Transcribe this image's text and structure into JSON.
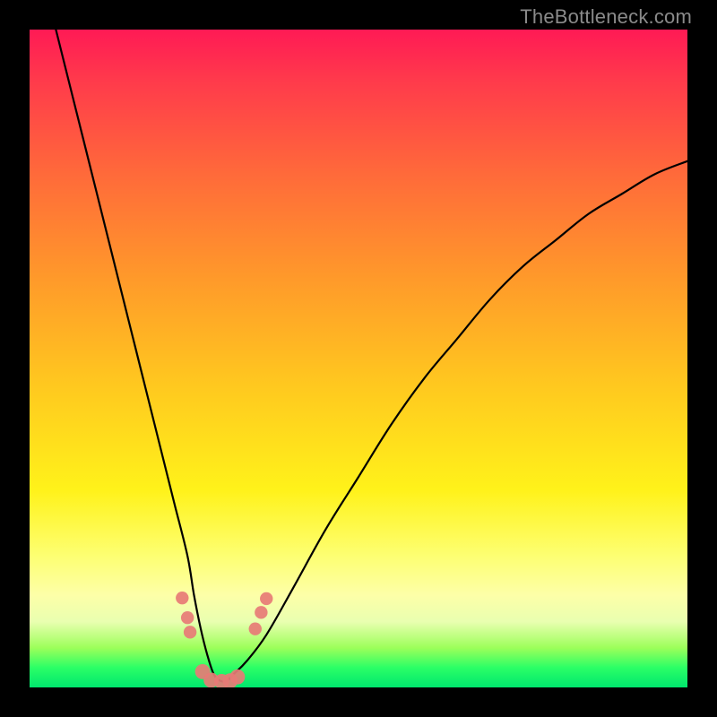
{
  "watermark": {
    "text": "TheBottleneck.com"
  },
  "chart_data": {
    "type": "line",
    "title": "",
    "xlabel": "",
    "ylabel": "",
    "xlim": [
      0,
      100
    ],
    "ylim": [
      0,
      100
    ],
    "grid": false,
    "legend": false,
    "series": [
      {
        "name": "curve",
        "color": "#000000",
        "x": [
          4,
          6,
          8,
          10,
          12,
          14,
          16,
          18,
          20,
          22,
          24,
          25,
          26,
          27,
          28,
          29,
          30,
          31,
          33,
          36,
          40,
          45,
          50,
          55,
          60,
          65,
          70,
          75,
          80,
          85,
          90,
          95,
          100
        ],
        "y": [
          100,
          92,
          84,
          76,
          68,
          60,
          52,
          44,
          36,
          28,
          20,
          14,
          9,
          5,
          2,
          1,
          1,
          2,
          4,
          8,
          15,
          24,
          32,
          40,
          47,
          53,
          59,
          64,
          68,
          72,
          75,
          78,
          80
        ]
      }
    ],
    "markers": [
      {
        "x": 23.2,
        "y": 13.6,
        "r": 1.2,
        "color": "#e77b76"
      },
      {
        "x": 24.0,
        "y": 10.6,
        "r": 1.2,
        "color": "#e77b76"
      },
      {
        "x": 24.4,
        "y": 8.4,
        "r": 1.2,
        "color": "#e77b76"
      },
      {
        "x": 26.3,
        "y": 2.4,
        "r": 1.4,
        "color": "#e77b76"
      },
      {
        "x": 27.6,
        "y": 1.1,
        "r": 1.4,
        "color": "#e77b76"
      },
      {
        "x": 29.2,
        "y": 0.9,
        "r": 1.4,
        "color": "#e77b76"
      },
      {
        "x": 30.5,
        "y": 1.0,
        "r": 1.4,
        "color": "#e77b76"
      },
      {
        "x": 31.6,
        "y": 1.6,
        "r": 1.4,
        "color": "#e77b76"
      },
      {
        "x": 34.3,
        "y": 8.9,
        "r": 1.2,
        "color": "#e77b76"
      },
      {
        "x": 35.2,
        "y": 11.4,
        "r": 1.2,
        "color": "#e77b76"
      },
      {
        "x": 36.0,
        "y": 13.5,
        "r": 1.2,
        "color": "#e77b76"
      }
    ]
  }
}
